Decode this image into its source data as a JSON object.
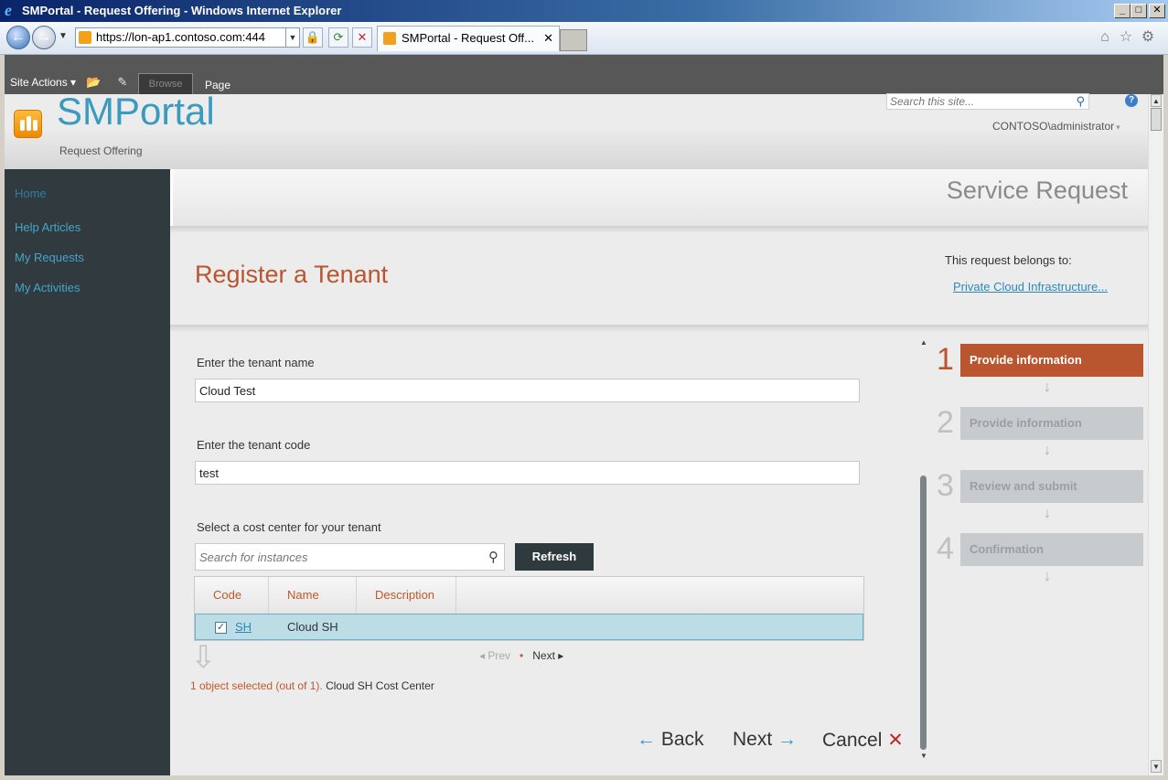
{
  "window": {
    "title": "SMPortal - Request Offering - Windows Internet Explorer",
    "controls": {
      "minimize": "_",
      "maximize": "□",
      "close": "✕"
    }
  },
  "browser": {
    "address_prefix": "https://lon-ap1.",
    "address_host": "contoso.com",
    "address_suffix": ":444",
    "tab_title": "SMPortal - Request Off...",
    "tab_close": "✕"
  },
  "ribbon": {
    "site_actions": "Site Actions ▾",
    "tabs": {
      "browse": "Browse",
      "page": "Page"
    }
  },
  "header": {
    "site_title": "SMPortal",
    "site_subtitle": "Request Offering",
    "search_placeholder": "Search this site...",
    "user": "CONTOSO\\administrator",
    "help_glyph": "?"
  },
  "nav": {
    "items": [
      {
        "label": "Home"
      },
      {
        "label": "Help Articles"
      },
      {
        "label": "My Requests"
      },
      {
        "label": "My Activities"
      }
    ]
  },
  "main": {
    "band_title": "Service Request",
    "offering_title": "Register a Tenant",
    "belongs_label": "This request belongs to:",
    "belongs_link": "Private Cloud Infrastructure...",
    "fields": {
      "tenant_name_label": "Enter the tenant name",
      "tenant_name_value": "Cloud Test",
      "tenant_code_label": "Enter the tenant code",
      "tenant_code_value": "test",
      "cost_center_label": "Select a cost center for your tenant"
    },
    "instance_search_placeholder": "Search for instances",
    "refresh_label": "Refresh",
    "grid": {
      "columns": [
        "Code",
        "Name",
        "Description"
      ],
      "rows": [
        {
          "selected": true,
          "code": "SH",
          "name": "Cloud SH",
          "description": ""
        }
      ]
    },
    "pager": {
      "prev": "◂ Prev",
      "dot": "•",
      "next": "Next ▸"
    },
    "selection": {
      "count": "1 object selected (out of 1).",
      "description": "Cloud SH Cost Center"
    },
    "buttons": {
      "back": "Back",
      "next": "Next",
      "cancel": "Cancel"
    }
  },
  "steps": [
    {
      "number": "1",
      "label": "Provide information",
      "active": true
    },
    {
      "number": "2",
      "label": "Provide information",
      "active": false
    },
    {
      "number": "3",
      "label": "Review and submit",
      "active": false
    },
    {
      "number": "4",
      "label": "Confirmation",
      "active": false
    }
  ],
  "colors": {
    "accent": "#b9552f",
    "link": "#2d88b8",
    "nav_bg": "#303a3f",
    "title_blue": "#3a9bbf"
  }
}
